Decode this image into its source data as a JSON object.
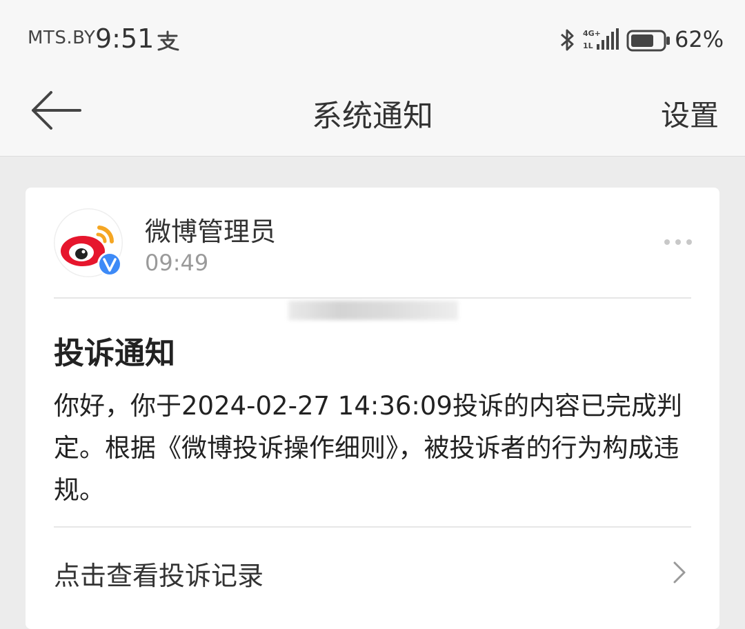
{
  "status_bar": {
    "carrier": "MTS.BY",
    "time": "9:51",
    "battery": "62%",
    "network": "4G"
  },
  "nav": {
    "title": "系统通知",
    "settings_label": "设置"
  },
  "message": {
    "sender": "微博管理员",
    "time": "09:49",
    "title": "投诉通知",
    "body": "你好，你于2024-02-27 14:36:09投诉的内容已完成判定。根据《微博投诉操作细则》，被投诉者的行为构成违规。",
    "link_label": "点击查看投诉记录"
  },
  "colors": {
    "weibo_red": "#e6162d",
    "weibo_orange": "#f5a623",
    "verified_blue": "#3d8af7"
  }
}
